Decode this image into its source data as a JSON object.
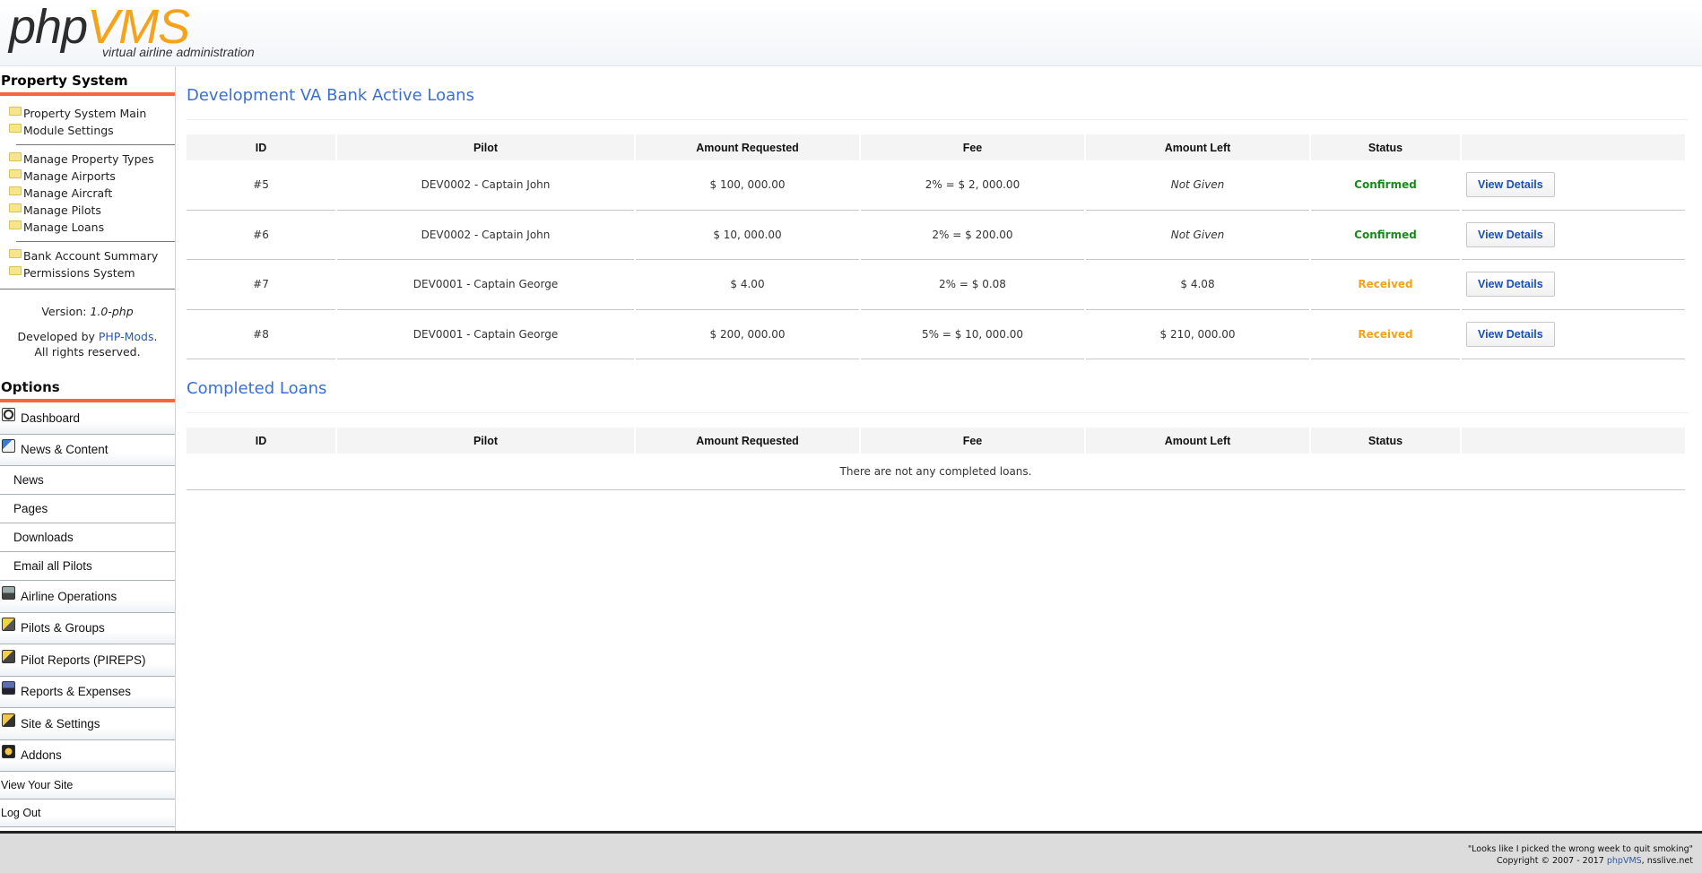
{
  "header": {
    "logo_php": "php",
    "logo_vms": "VMS",
    "logo_sub": "virtual airline administration"
  },
  "sidebar": {
    "property_title": "Property System",
    "links_group1": [
      "Property System Main",
      "Module Settings"
    ],
    "links_group2": [
      "Manage Property Types",
      "Manage Airports",
      "Manage Aircraft",
      "Manage Pilots",
      "Manage Loans"
    ],
    "links_group3": [
      "Bank Account Summary",
      "Permissions System"
    ],
    "version_label": "Version:",
    "version_value": "1.0-php",
    "developed_label": "Developed by",
    "developer": "PHP-Mods",
    "rights": "All rights reserved.",
    "options_title": "Options",
    "menu": {
      "dashboard": "Dashboard",
      "news_content": "News & Content",
      "news": "News",
      "pages": "Pages",
      "downloads": "Downloads",
      "email_pilots": "Email all Pilots",
      "airline_ops": "Airline Operations",
      "pilots_groups": "Pilots & Groups",
      "pireps": "Pilot Reports (PIREPS)",
      "reports": "Reports & Expenses",
      "site_settings": "Site & Settings",
      "addons": "Addons",
      "view_site": "View Your Site",
      "logout": "Log Out"
    },
    "icons": [
      "dashboard-icon",
      "news-icon",
      "airline-icon",
      "pilots-icon",
      "pireps-icon",
      "reports-icon",
      "settings-icon",
      "addons-icon",
      "folder-icon"
    ]
  },
  "active_loans": {
    "title": "Development VA Bank Active Loans",
    "headers": [
      "ID",
      "Pilot",
      "Amount Requested",
      "Fee",
      "Amount Left",
      "Status",
      ""
    ],
    "rows": [
      {
        "id": "#5",
        "pilot": "DEV0002 - Captain John",
        "amount": "$ 100, 000.00",
        "fee": "2% = $ 2, 000.00",
        "left": "Not Given",
        "status": "Confirmed",
        "action": "View Details"
      },
      {
        "id": "#6",
        "pilot": "DEV0002 - Captain John",
        "amount": "$ 10, 000.00",
        "fee": "2% = $ 200.00",
        "left": "Not Given",
        "status": "Confirmed",
        "action": "View Details"
      },
      {
        "id": "#7",
        "pilot": "DEV0001 - Captain George",
        "amount": "$ 4.00",
        "fee": "2% = $ 0.08",
        "left": "$ 4.08",
        "status": "Received",
        "action": "View Details"
      },
      {
        "id": "#8",
        "pilot": "DEV0001 - Captain George",
        "amount": "$ 200, 000.00",
        "fee": "5% = $ 10, 000.00",
        "left": "$ 210, 000.00",
        "status": "Received",
        "action": "View Details"
      }
    ],
    "status_colors": {
      "Confirmed": "#1a8a1a",
      "Received": "#f0a31c"
    }
  },
  "completed_loans": {
    "title": "Completed Loans",
    "headers": [
      "ID",
      "Pilot",
      "Amount Requested",
      "Fee",
      "Amount Left",
      "Status",
      ""
    ],
    "empty_message": "There are not any completed loans."
  },
  "footer": {
    "quote": "\"Looks like I picked the wrong week to quit smoking\"",
    "copyright_pre": "Copyright © 2007 - 2017",
    "copyright_link": "phpVMS",
    "copyright_post": ", nsslive.net"
  },
  "colors": {
    "accent": "#f26a36",
    "heading": "#3b6fd6",
    "link": "#2d5aa6"
  }
}
